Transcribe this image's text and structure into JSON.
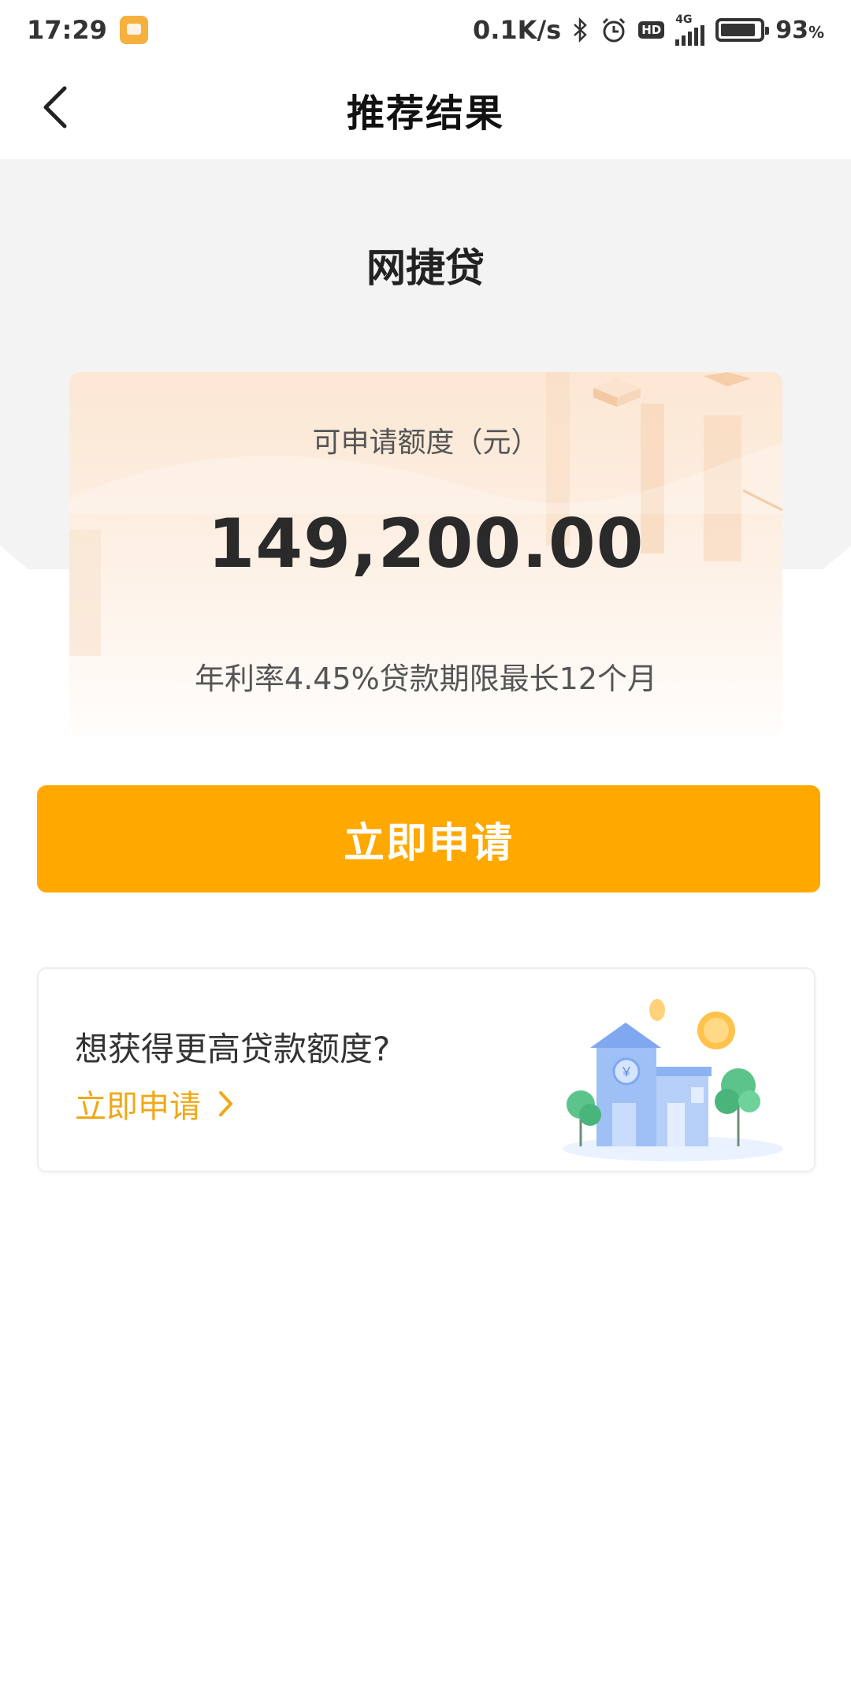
{
  "status_bar": {
    "time": "17:29",
    "speed": "0.1K/s",
    "hd": "HD",
    "network": "4G",
    "battery_percent": "93",
    "battery_unit": "%"
  },
  "nav": {
    "title": "推荐结果"
  },
  "product": {
    "name": "网捷贷"
  },
  "quota": {
    "label": "可申请额度（元）",
    "amount": "149,200.00",
    "terms": "年利率4.45%贷款期限最长12个月"
  },
  "apply_button": {
    "label": "立即申请"
  },
  "promo": {
    "title": "想获得更高贷款额度?",
    "link_label": "立即申请"
  },
  "colors": {
    "accent": "#FFA800",
    "link": "#F0A818",
    "background_band": "#F3F3F3"
  },
  "icons": [
    "back-arrow-icon",
    "bluetooth-icon",
    "alarm-icon",
    "signal-icon",
    "battery-icon",
    "chevron-right-icon",
    "bank-building-illustration"
  ]
}
